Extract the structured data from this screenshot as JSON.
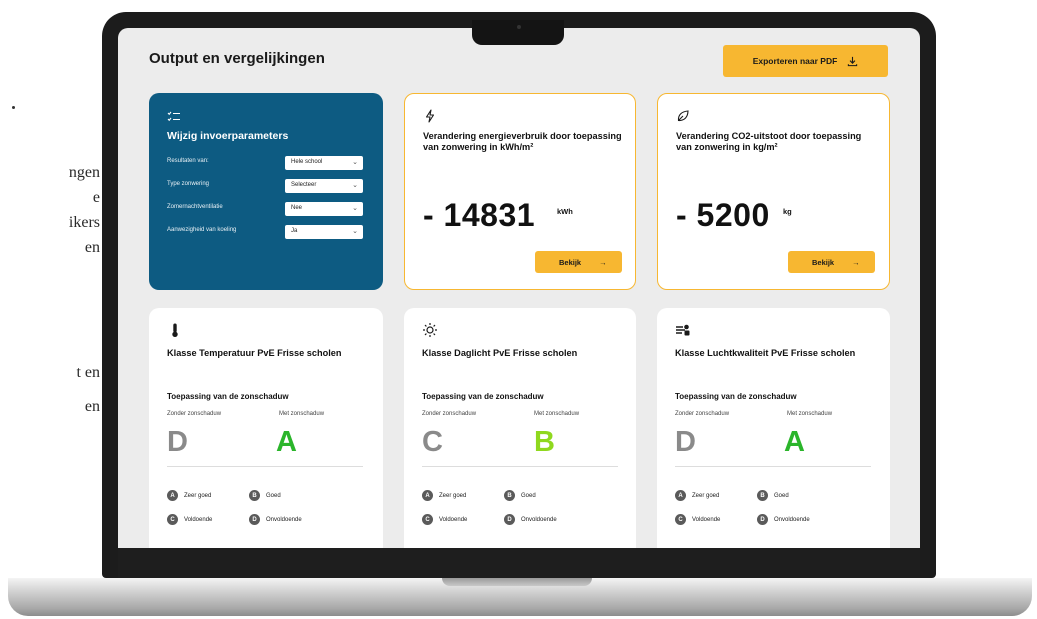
{
  "side_text": {
    "line1": "ngen",
    "line2": "e",
    "line3": "ikers",
    "line4": "en",
    "line5": "t en",
    "line6": "en"
  },
  "page": {
    "title": "Output en vergelijkingen",
    "export_label": "Exporteren naar PDF"
  },
  "params": {
    "title": "Wijzig invoerparameters",
    "rows": [
      {
        "label": "Resultaten van:",
        "value": "Hele school"
      },
      {
        "label": "Type zonwering",
        "value": "Selecteer"
      },
      {
        "label": "Zomernachtventilatie",
        "value": "Nee"
      },
      {
        "label": "Aanwezigheid van koeling",
        "value": "Ja"
      }
    ]
  },
  "energy": {
    "title": "Verandering energieverbruik door toepassing van zonwering in kWh/m²",
    "value": "- 14831",
    "unit": "kWh",
    "button": "Bekijk"
  },
  "co2": {
    "title": "Verandering CO2-uitstoot door toepassing van zonwering in kg/m²",
    "value": "- 5200",
    "unit": "kg",
    "button": "Bekijk"
  },
  "classes": {
    "subtitle": "Toepassing van de zonschaduw",
    "without_label": "Zonder zonschaduw",
    "with_label": "Met zonschaduw",
    "legend": [
      {
        "badge": "A",
        "label": "Zeer goed"
      },
      {
        "badge": "B",
        "label": "Goed"
      },
      {
        "badge": "C",
        "label": "Voldoende"
      },
      {
        "badge": "D",
        "label": "Onvoldoende"
      }
    ],
    "cards": [
      {
        "title": "Klasse Temperatuur PvE Frisse scholen",
        "without": "D",
        "with": "A",
        "with_color": "#2bb52b",
        "icon": "thermometer-icon"
      },
      {
        "title": "Klasse Daglicht PvE Frisse scholen",
        "without": "C",
        "with": "B",
        "with_color": "#8fd81e",
        "icon": "sun-icon"
      },
      {
        "title": "Klasse Luchtkwaliteit PvE Frisse scholen",
        "without": "D",
        "with": "A",
        "with_color": "#2bb52b",
        "icon": "air-quality-icon"
      }
    ]
  },
  "colors": {
    "accent": "#f7b731",
    "panel_blue": "#0d5b82",
    "grade_gray": "#8a8a8a"
  }
}
